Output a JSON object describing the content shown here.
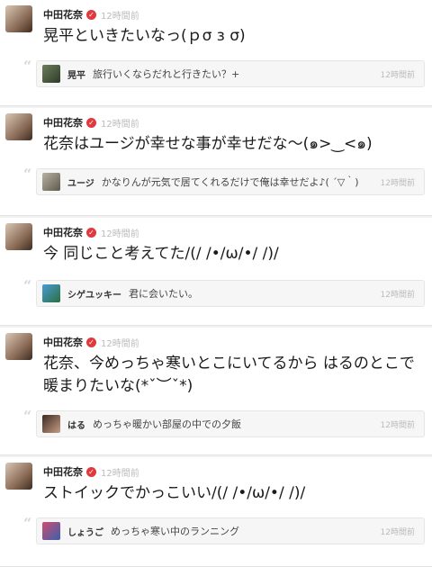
{
  "posts": [
    {
      "author": "中田花奈",
      "time": "12時間前",
      "text": "晃平といきたいなっ(ｐσ з σ)",
      "reply": {
        "name": "晃平",
        "text": "旅行いくならだれと行きたい？+",
        "time": "12時間前"
      }
    },
    {
      "author": "中田花奈",
      "time": "12時間前",
      "text": "花奈はユージが幸せな事が幸せだな〜(๑>‿<๑)",
      "reply": {
        "name": "ユージ",
        "text": "かなりんが元気で居てくれるだけで俺は幸せだよ♪( ´▽｀)",
        "time": "12時間前"
      }
    },
    {
      "author": "中田花奈",
      "time": "12時間前",
      "text": "今 同じこと考えてた/(/ /•/ω/•/ /)/",
      "reply": {
        "name": "シゲユッキー",
        "text": "君に会いたい。",
        "time": "12時間前"
      }
    },
    {
      "author": "中田花奈",
      "time": "12時間前",
      "text": "花奈、今めっちゃ寒いとこにいてるから はるのとこで暖まりたいな(*ˇ︶ˇ*)",
      "reply": {
        "name": "はる",
        "text": "めっちゃ暖かい部屋の中での夕飯",
        "time": "12時間前"
      }
    },
    {
      "author": "中田花奈",
      "time": "12時間前",
      "text": "ストイックでかっこいい/(/ /•/ω/•/ /)/",
      "reply": {
        "name": "しょうご",
        "text": "めっちゃ寒い中のランニング",
        "time": "12時間前"
      }
    }
  ]
}
